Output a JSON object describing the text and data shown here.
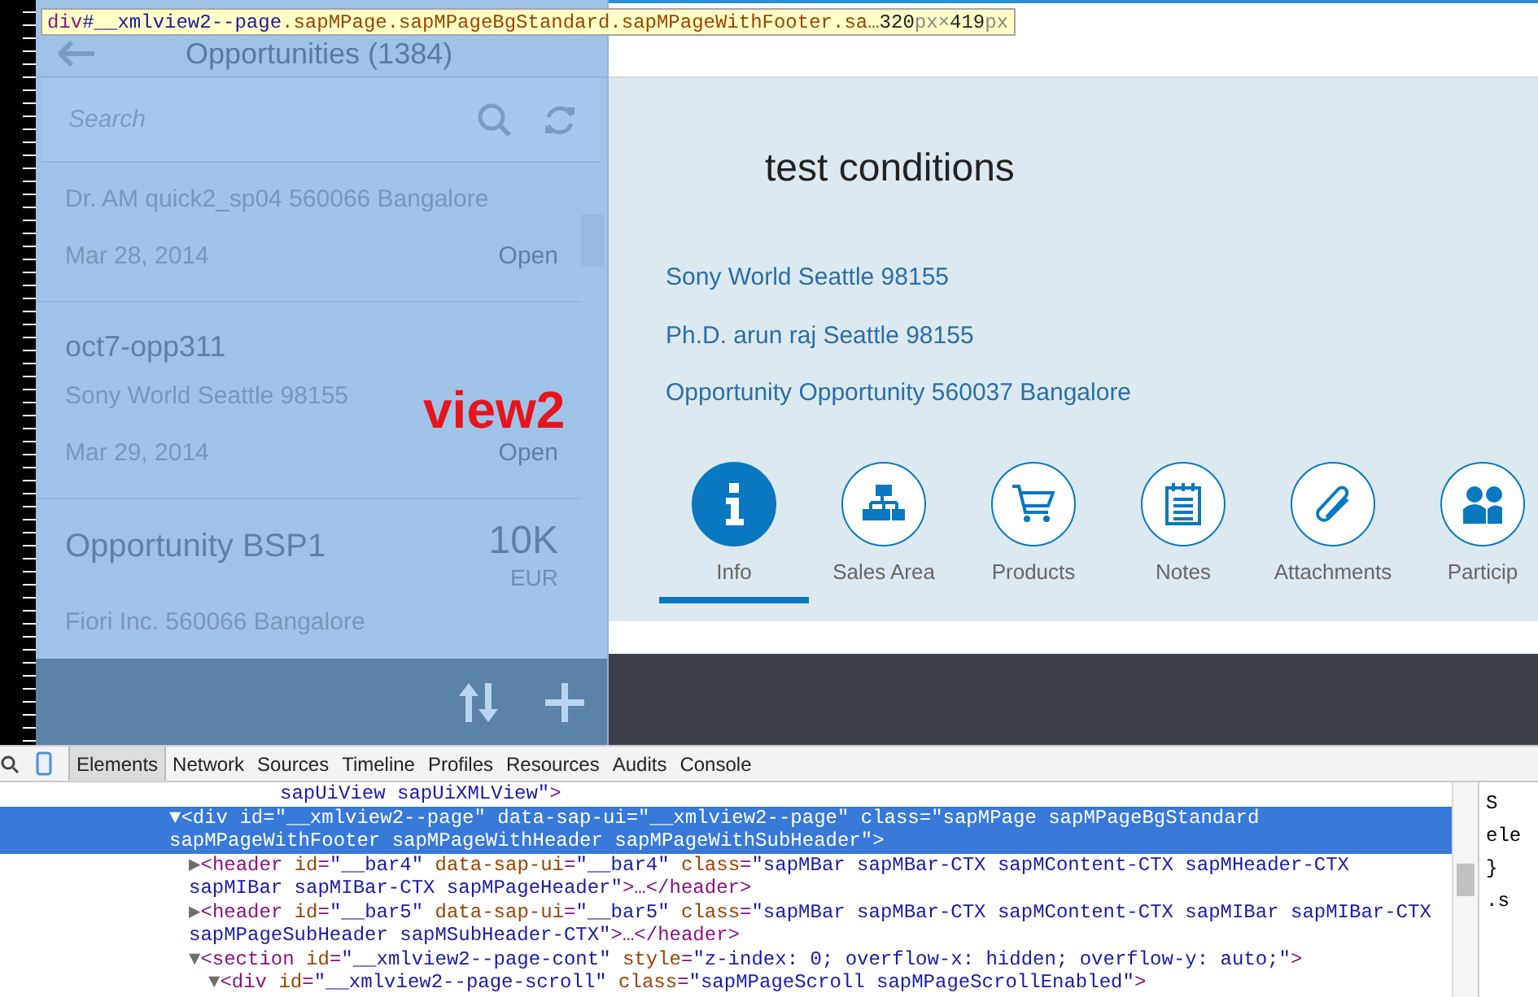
{
  "tooltip": {
    "tag": "div",
    "id": "#__xmlview2--page",
    "classes": ".sapMPage.sapMPageBgStandard.sapMPageWithFooter.sa…",
    "size": [
      {
        "kind": "number",
        "text": "320"
      },
      {
        "kind": "unit",
        "text": "px"
      },
      {
        "kind": "unit",
        "text": " × "
      },
      {
        "kind": "number",
        "text": "419"
      },
      {
        "kind": "unit",
        "text": "px"
      }
    ]
  },
  "master": {
    "title": "Opportunities (1384)",
    "search": {
      "placeholder": "Search"
    },
    "items": [
      {
        "address": "Dr. AM quick2_sp04 560066 Bangalore",
        "date": "Mar 28, 2014",
        "status": "Open"
      },
      {
        "title": "oct7-opp311",
        "address": "Sony World Seattle 98155",
        "date": "Mar 29, 2014",
        "status": "Open"
      },
      {
        "title": "Opportunity BSP1",
        "amount": "10K",
        "currency": "EUR",
        "address": "Fiori Inc. 560066 Bangalore"
      }
    ],
    "overlay_label": "view2"
  },
  "detail": {
    "title": "test conditions",
    "lines": [
      "Sony World Seattle 98155",
      "Ph.D. arun raj Seattle 98155",
      "Opportunity Opportunity 560037 Bangalore"
    ],
    "tabs": [
      {
        "kind": "info",
        "label": "Info",
        "selected": true
      },
      {
        "kind": "hierarchy",
        "label": "Sales Area",
        "selected": false
      },
      {
        "kind": "cart",
        "label": "Products",
        "selected": false
      },
      {
        "kind": "notes",
        "label": "Notes",
        "selected": false
      },
      {
        "kind": "paperclip",
        "label": "Attachments",
        "selected": false
      },
      {
        "kind": "people",
        "label": "Particip",
        "selected": false
      }
    ]
  },
  "devtools": {
    "tabs": [
      {
        "label": "Elements",
        "selected": true
      },
      {
        "label": "Network",
        "selected": false
      },
      {
        "label": "Sources",
        "selected": false
      },
      {
        "label": "Timeline",
        "selected": false
      },
      {
        "label": "Profiles",
        "selected": false
      },
      {
        "label": "Resources",
        "selected": false
      },
      {
        "label": "Audits",
        "selected": false
      },
      {
        "label": "Console",
        "selected": false
      }
    ],
    "tree": [
      {
        "selected": false,
        "segments": [
          {
            "kind": "value",
            "text": "sapUiView sapUiXMLView\""
          },
          {
            "kind": "punct",
            "text": ">"
          }
        ],
        "children": [
          {
            "toggle": "▼",
            "selected": true,
            "text": "<div id=\"__xmlview2--page\" data-sap-ui=\"__xmlview2--page\" class=\"sapMPage sapMPageBgStandard sapMPageWithFooter sapMPageWithHeader sapMPageWithSubHeader\">",
            "children": [
              {
                "toggle": "▶",
                "selected": false,
                "segments": [
                  {
                    "kind": "punct",
                    "text": "<"
                  },
                  {
                    "kind": "tag",
                    "text": "header"
                  },
                  {
                    "kind": "attr",
                    "text": " id"
                  },
                  {
                    "kind": "punct",
                    "text": "="
                  },
                  {
                    "kind": "value",
                    "text": "\"__bar4\""
                  },
                  {
                    "kind": "attr",
                    "text": " data-sap-ui"
                  },
                  {
                    "kind": "punct",
                    "text": "="
                  },
                  {
                    "kind": "value",
                    "text": "\"__bar4\""
                  },
                  {
                    "kind": "attr",
                    "text": " class"
                  },
                  {
                    "kind": "punct",
                    "text": "="
                  },
                  {
                    "kind": "value",
                    "text": "\"sapMBar sapMBar-CTX sapMContent-CTX sapMHeader-CTX sapMIBar sapMIBar-CTX sapMPageHeader\""
                  },
                  {
                    "kind": "punct",
                    "text": ">…</"
                  },
                  {
                    "kind": "tag",
                    "text": "header"
                  },
                  {
                    "kind": "punct",
                    "text": ">"
                  }
                ]
              },
              {
                "toggle": "▶",
                "selected": false,
                "segments": [
                  {
                    "kind": "punct",
                    "text": "<"
                  },
                  {
                    "kind": "tag",
                    "text": "header"
                  },
                  {
                    "kind": "attr",
                    "text": " id"
                  },
                  {
                    "kind": "punct",
                    "text": "="
                  },
                  {
                    "kind": "value",
                    "text": "\"__bar5\""
                  },
                  {
                    "kind": "attr",
                    "text": " data-sap-ui"
                  },
                  {
                    "kind": "punct",
                    "text": "="
                  },
                  {
                    "kind": "value",
                    "text": "\"__bar5\""
                  },
                  {
                    "kind": "attr",
                    "text": " class"
                  },
                  {
                    "kind": "punct",
                    "text": "="
                  },
                  {
                    "kind": "value",
                    "text": "\"sapMBar sapMBar-CTX sapMContent-CTX sapMIBar sapMIBar-CTX sapMPageSubHeader sapMSubHeader-CTX\""
                  },
                  {
                    "kind": "punct",
                    "text": ">…</"
                  },
                  {
                    "kind": "tag",
                    "text": "header"
                  },
                  {
                    "kind": "punct",
                    "text": ">"
                  }
                ]
              },
              {
                "toggle": "▼",
                "selected": false,
                "segments": [
                  {
                    "kind": "punct",
                    "text": "<"
                  },
                  {
                    "kind": "tag",
                    "text": "section"
                  },
                  {
                    "kind": "attr",
                    "text": " id"
                  },
                  {
                    "kind": "punct",
                    "text": "="
                  },
                  {
                    "kind": "value",
                    "text": "\"__xmlview2--page-cont\""
                  },
                  {
                    "kind": "attr",
                    "text": " style"
                  },
                  {
                    "kind": "punct",
                    "text": "="
                  },
                  {
                    "kind": "value",
                    "text": "\"z-index: 0; overflow-x: hidden; overflow-y: auto;\""
                  },
                  {
                    "kind": "punct",
                    "text": ">"
                  }
                ],
                "children": [
                  {
                    "toggle": "▼",
                    "selected": false,
                    "segments": [
                      {
                        "kind": "punct",
                        "text": "<"
                      },
                      {
                        "kind": "tag",
                        "text": "div"
                      },
                      {
                        "kind": "attr",
                        "text": " id"
                      },
                      {
                        "kind": "punct",
                        "text": "="
                      },
                      {
                        "kind": "value",
                        "text": "\"__xmlview2--page-scroll\""
                      },
                      {
                        "kind": "attr",
                        "text": " class"
                      },
                      {
                        "kind": "punct",
                        "text": "="
                      },
                      {
                        "kind": "value",
                        "text": "\"sapMPageScroll sapMPageScrollEnabled\""
                      },
                      {
                        "kind": "punct",
                        "text": ">"
                      }
                    ]
                  }
                ]
              }
            ]
          }
        ]
      }
    ],
    "side_fragments": [
      "S",
      "ele",
      "}",
      ".s"
    ]
  }
}
